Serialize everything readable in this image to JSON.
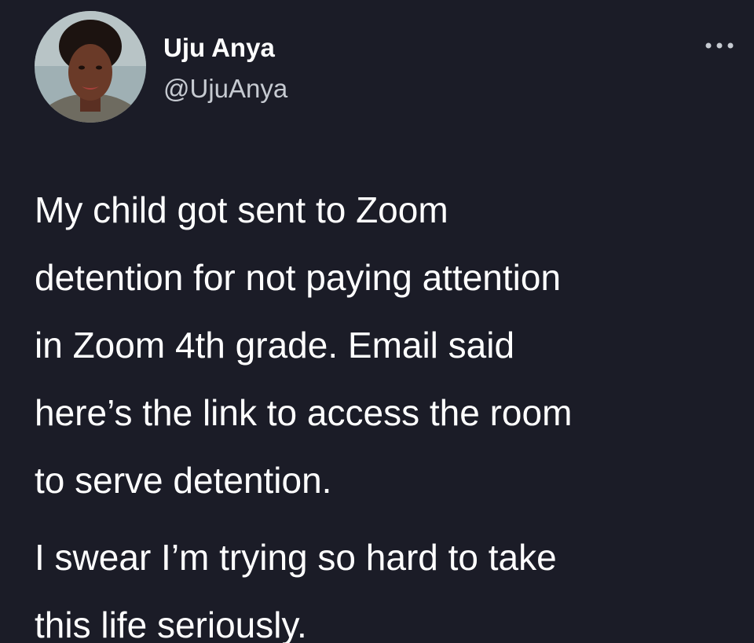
{
  "author": {
    "name": "Uju Anya",
    "handle": "@UjuAnya",
    "avatar_icon": "user-profile-photo"
  },
  "menu": {
    "more_icon": "more-horizontal-icon"
  },
  "tweet": {
    "paragraph1": {
      "line1": "My child got sent to Zoom",
      "line2": "detention for not paying attention",
      "line3": "in Zoom 4th grade. Email said",
      "line4": "here’s the link to access the room",
      "line5": "to serve detention."
    },
    "paragraph2": {
      "line1": "I swear I’m trying so hard to take",
      "line2": "this life seriously."
    }
  },
  "colors": {
    "background": "#1b1c27",
    "text": "#ffffff",
    "handle": "#c6cad1"
  }
}
